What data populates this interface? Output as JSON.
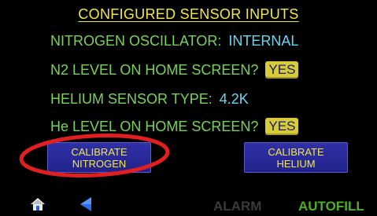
{
  "title": "CONFIGURED SENSOR INPUTS",
  "settings": {
    "nitrogen_oscillator": {
      "label": "NITROGEN OSCILLATOR:",
      "value": "INTERNAL"
    },
    "n2_on_home": {
      "label": "N2 LEVEL ON HOME SCREEN?",
      "button": "YES"
    },
    "helium_sensor_type": {
      "label": "HELIUM SENSOR TYPE:",
      "value": "4.2K"
    },
    "he_on_home": {
      "label": "He LEVEL ON HOME SCREEN?",
      "button": "YES"
    }
  },
  "buttons": {
    "calibrate_nitrogen": {
      "line1": "CALIBRATE",
      "line2": "NITROGEN"
    },
    "calibrate_helium": {
      "line1": "CALIBRATE",
      "line2": "HELIUM"
    }
  },
  "status_bar": {
    "alarm": "ALARM",
    "autofill": "AUTOFILL"
  },
  "icons": {
    "home": "home-icon",
    "back": "back-arrow-icon"
  },
  "colors": {
    "background": "#000000",
    "title": "#f2e84a",
    "label": "#79d35a",
    "value": "#66d8f0",
    "button_yes": "#d8cb3a",
    "button_blue": "#2a2a9a",
    "highlight": "#e02020",
    "alarm_inactive": "#3a3a3a",
    "autofill": "#4caf26"
  }
}
